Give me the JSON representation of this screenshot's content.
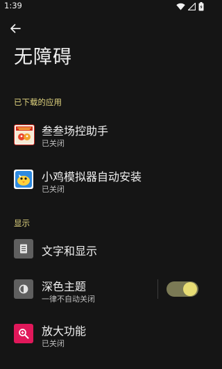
{
  "status_bar": {
    "time": "1:39"
  },
  "header": {
    "back_icon": "arrow-left-icon",
    "title": "无障碍"
  },
  "sections": {
    "downloaded": {
      "title": "已下载的应用",
      "items": [
        {
          "title": "叁叁场控助手",
          "subtitle": "已关闭",
          "icon": "app-icon-sansan"
        },
        {
          "title": "小鸡模拟器自动安装",
          "subtitle": "已关闭",
          "icon": "app-icon-xiaoji"
        }
      ]
    },
    "display": {
      "title": "显示",
      "items": [
        {
          "title": "文字和显示",
          "icon": "text-display-icon"
        },
        {
          "title": "深色主题",
          "subtitle": "一律不自动关闭",
          "icon": "dark-theme-icon",
          "toggle_on": true
        },
        {
          "title": "放大功能",
          "subtitle": "已关闭",
          "icon": "magnify-icon"
        }
      ]
    }
  },
  "colors": {
    "background": "#151515",
    "section_title": "#e3d680",
    "toggle_track": "#7b7a55",
    "toggle_knob": "#e7dc74",
    "magnify_icon_bg": "#e0185a",
    "gray_icon_bg": "#5f5f5f"
  }
}
